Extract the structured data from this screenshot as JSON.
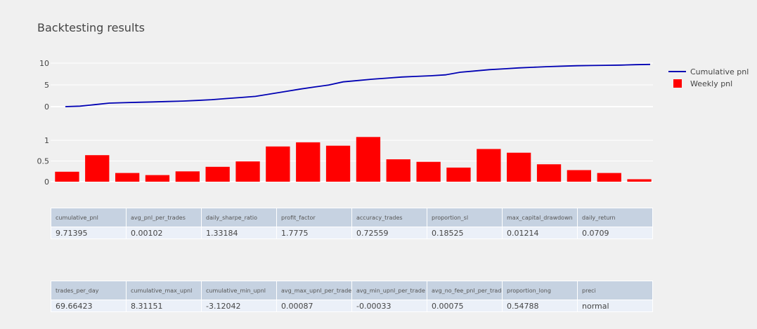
{
  "title": "Backtesting results",
  "colors": {
    "line": "#0000b3",
    "bar": "#ff0000",
    "table_header": "#c6d2e1",
    "table_cell": "#ebf0f8"
  },
  "chart_data": [
    {
      "type": "line",
      "name": "Cumulative pnl",
      "x": [
        0,
        1,
        2,
        3,
        4,
        5,
        6,
        7,
        8,
        9,
        10,
        11,
        12,
        13,
        14,
        15,
        16,
        17,
        18,
        19,
        20,
        21,
        22,
        23,
        24,
        25,
        26,
        27,
        28,
        29,
        30,
        31,
        32,
        33,
        34,
        35,
        36,
        37,
        38,
        39,
        40
      ],
      "values": [
        0,
        0.12,
        0.45,
        0.8,
        0.9,
        1.0,
        1.08,
        1.18,
        1.28,
        1.42,
        1.6,
        1.85,
        2.1,
        2.35,
        2.9,
        3.45,
        4.0,
        4.5,
        4.95,
        5.7,
        6.0,
        6.3,
        6.55,
        6.8,
        6.95,
        7.1,
        7.3,
        7.9,
        8.2,
        8.5,
        8.7,
        8.9,
        9.05,
        9.2,
        9.3,
        9.4,
        9.45,
        9.5,
        9.55,
        9.65,
        9.71
      ],
      "yticks": [
        0,
        5,
        10
      ],
      "ylim": [
        -1,
        11.5
      ]
    },
    {
      "type": "bar",
      "name": "Weekly pnl",
      "values": [
        0.24,
        0.64,
        0.21,
        0.16,
        0.25,
        0.36,
        0.49,
        0.85,
        0.95,
        0.87,
        1.08,
        0.54,
        0.48,
        0.34,
        0.79,
        0.7,
        0.42,
        0.28,
        0.21,
        0.06
      ],
      "yticks": [
        0,
        0.5,
        1
      ],
      "ylim": [
        0,
        1.15
      ]
    }
  ],
  "legend": [
    {
      "label": "Cumulative pnl",
      "kind": "line"
    },
    {
      "label": "Weekly pnl",
      "kind": "square"
    }
  ],
  "tables": [
    {
      "headers": [
        "cumulative_pnl",
        "avg_pnl_per_trades",
        "daily_sharpe_ratio",
        "profit_factor",
        "accuracy_trades",
        "proportion_sl",
        "max_capital_drawdown",
        "daily_return"
      ],
      "values": [
        "9.71395",
        "0.00102",
        "1.33184",
        "1.7775",
        "0.72559",
        "0.18525",
        "0.01214",
        "0.0709"
      ]
    },
    {
      "headers": [
        "trades_per_day",
        "cumulative_max_upnl",
        "cumulative_min_upnl",
        "avg_max_upnl_per_trade",
        "avg_min_upnl_per_trade",
        "avg_no_fee_pnl_per_trade",
        "proportion_long",
        "preci"
      ],
      "values": [
        "69.66423",
        "8.31151",
        "-3.12042",
        "0.00087",
        "-0.00033",
        "0.00075",
        "0.54788",
        "normal"
      ]
    }
  ]
}
